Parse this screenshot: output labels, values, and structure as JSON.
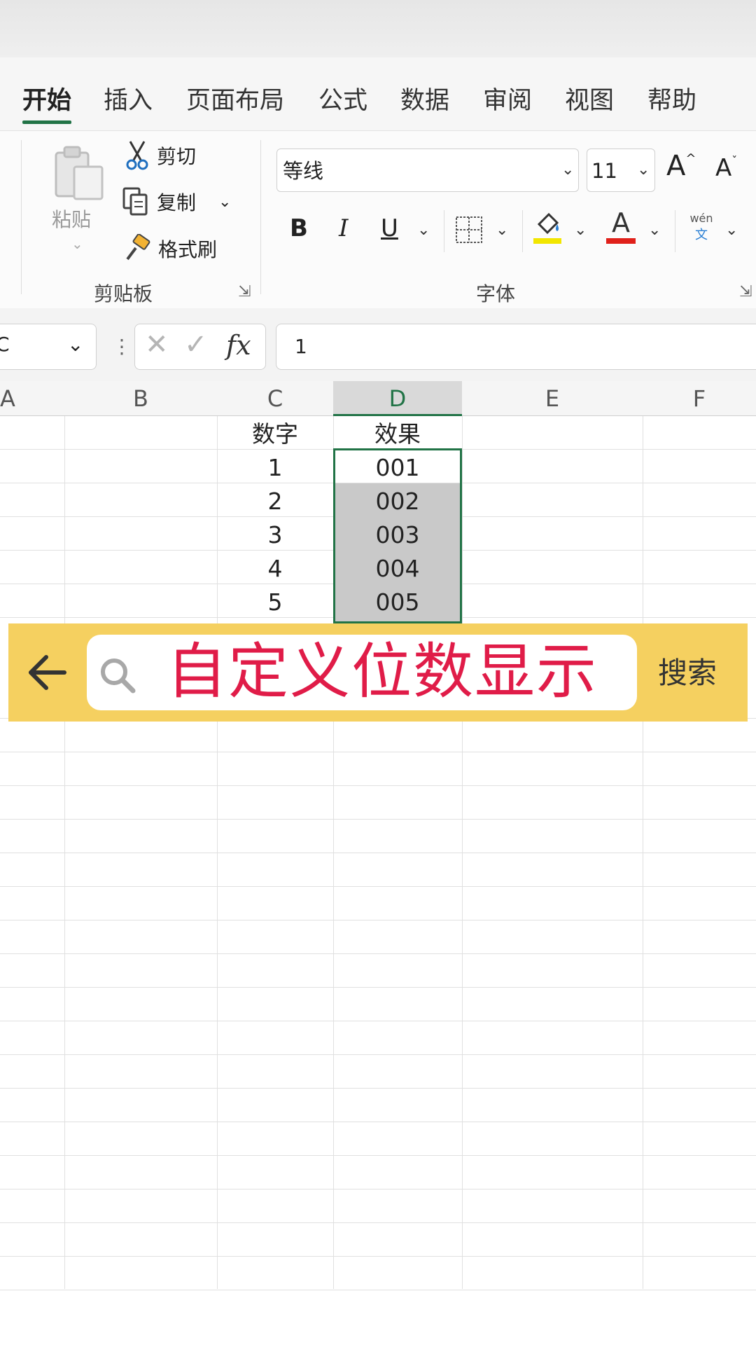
{
  "tabs": [
    {
      "label": "开始",
      "active": true
    },
    {
      "label": "插入"
    },
    {
      "label": "页面布局"
    },
    {
      "label": "公式"
    },
    {
      "label": "数据"
    },
    {
      "label": "审阅"
    },
    {
      "label": "视图"
    },
    {
      "label": "帮助"
    }
  ],
  "clipboard": {
    "paste_label": "粘贴",
    "cut_label": "剪切",
    "copy_label": "复制",
    "format_painter_label": "格式刷",
    "group_label": "剪贴板"
  },
  "font": {
    "font_name": "等线",
    "font_size": "11",
    "group_label": "字体",
    "bold": "B",
    "italic": "I",
    "underline": "U",
    "grow": "A",
    "shrink": "A",
    "font_color_glyph": "A",
    "phonetic_top": "wén",
    "phonetic_bottom": "文"
  },
  "formula_bar": {
    "name_box": "C",
    "fx": "fx",
    "value": "1"
  },
  "columns": [
    "A",
    "B",
    "C",
    "D",
    "E",
    "F"
  ],
  "selected_column": "D",
  "sheet": {
    "header_c": "数字",
    "header_d": "效果",
    "rows": [
      {
        "c": "1",
        "d": "001"
      },
      {
        "c": "2",
        "d": "002"
      },
      {
        "c": "3",
        "d": "003"
      },
      {
        "c": "4",
        "d": "004"
      },
      {
        "c": "5",
        "d": "005"
      }
    ]
  },
  "banner": {
    "title": "自定义位数显示",
    "search_label": "搜索"
  },
  "colors": {
    "accent": "#217346",
    "banner_bg": "#f5d060",
    "banner_text": "#e01c48",
    "fill_color": "#f2e600",
    "font_color": "#e0201a"
  }
}
